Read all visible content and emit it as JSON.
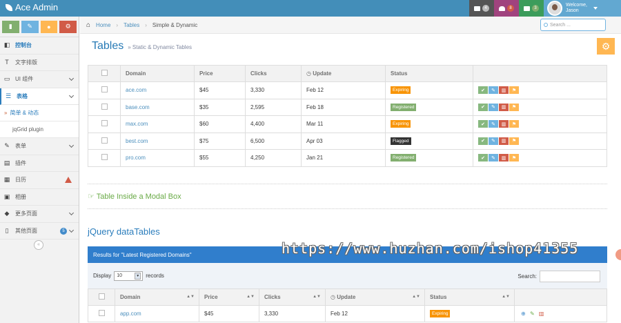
{
  "navbar": {
    "brand": "Ace Admin",
    "icons": [
      {
        "name": "tasks-icon",
        "count": "4",
        "bg": "#555555",
        "badge": "#bbbbbb"
      },
      {
        "name": "bell-icon",
        "count": "8",
        "bg": "#a0437e",
        "badge": "#d15b47"
      },
      {
        "name": "envelope-icon",
        "count": "3",
        "bg": "#3c9c5b",
        "badge": "#82af6f"
      }
    ],
    "welcome": "Welcome,",
    "user": "Jason"
  },
  "sidebar": {
    "shortcuts": [
      {
        "name": "signal-icon",
        "color": "#82af6f"
      },
      {
        "name": "pencil-icon",
        "color": "#6fb3e0"
      },
      {
        "name": "group-icon",
        "color": "#ffb752"
      },
      {
        "name": "cogs-icon",
        "color": "#d15b47"
      }
    ],
    "items": [
      {
        "label": "控制台",
        "icon": "dashboard-icon"
      },
      {
        "label": "文字排版",
        "icon": "text-icon"
      },
      {
        "label": "UI 组件",
        "icon": "desktop-icon"
      },
      {
        "label": "表格",
        "icon": "list-icon"
      },
      {
        "label": "表单",
        "icon": "edit-icon"
      },
      {
        "label": "插件",
        "icon": "list-alt-icon"
      },
      {
        "label": "日历",
        "icon": "calendar-icon"
      },
      {
        "label": "相册",
        "icon": "picture-icon"
      },
      {
        "label": "更多页面",
        "icon": "tag-icon"
      },
      {
        "label": "其他页面",
        "icon": "file-icon",
        "badge": "5"
      }
    ],
    "submenu": [
      "简单 & 动态",
      "jqGrid plugin"
    ]
  },
  "breadcrumbs": {
    "home": "Home",
    "tables": "Tables",
    "current": "Simple & Dynamic"
  },
  "search": {
    "placeholder": "Search ..."
  },
  "header": {
    "title": "Tables",
    "subtitle": "» Static & Dynamic Tables"
  },
  "table1": {
    "headers": [
      "Domain",
      "Price",
      "Clicks",
      "Update",
      "Status"
    ],
    "rows": [
      {
        "domain": "ace.com",
        "price": "$45",
        "clicks": "3,330",
        "update": "Feb 12",
        "status": "Expiring",
        "status_type": "warning"
      },
      {
        "domain": "base.com",
        "price": "$35",
        "clicks": "2,595",
        "update": "Feb 18",
        "status": "Registered",
        "status_type": "success"
      },
      {
        "domain": "max.com",
        "price": "$60",
        "clicks": "4,400",
        "update": "Mar 11",
        "status": "Expiring",
        "status_type": "warning"
      },
      {
        "domain": "best.com",
        "price": "$75",
        "clicks": "6,500",
        "update": "Apr 03",
        "status": "Flagged",
        "status_type": "inverse"
      },
      {
        "domain": "pro.com",
        "price": "$55",
        "clicks": "4,250",
        "update": "Jan 21",
        "status": "Registered",
        "status_type": "success"
      }
    ],
    "action_colors": [
      "#87b87f",
      "#6fb3e0",
      "#d15b47",
      "#ffb752"
    ]
  },
  "modal_title": "Table Inside a Modal Box",
  "datatables": {
    "title": "jQuery dataTables",
    "results": "Results for \"Latest Registered Domains\"",
    "display": "Display",
    "display_value": "10",
    "records": "records",
    "search": "Search:",
    "headers": [
      "Domain",
      "Price",
      "Clicks",
      "Update",
      "Status"
    ],
    "rows": [
      {
        "domain": "app.com",
        "price": "$45",
        "clicks": "3,330",
        "update": "Feb 12",
        "status": "Expiring"
      }
    ]
  },
  "watermark": "https://www.huzhan.com/ishop41355"
}
